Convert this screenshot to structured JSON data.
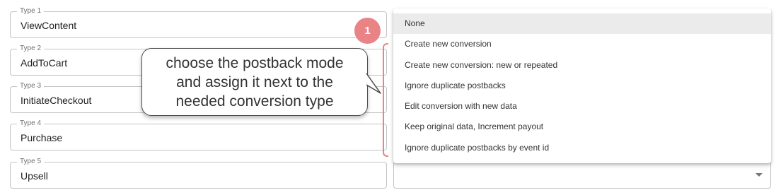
{
  "conversion_types": [
    {
      "label": "Type 1",
      "value": "ViewContent"
    },
    {
      "label": "Type 2",
      "value": "AddToCart"
    },
    {
      "label": "Type 3",
      "value": "InitiateCheckout"
    },
    {
      "label": "Type 4",
      "value": "Purchase"
    },
    {
      "label": "Type 5",
      "value": "Upsell"
    }
  ],
  "postback_mode": {
    "options": [
      "None",
      "Create new conversion",
      "Create new conversion: new or repeated",
      "Ignore duplicate postbacks",
      "Edit conversion with new data",
      "Keep original data, Increment payout",
      "Ignore duplicate postbacks by event id"
    ],
    "selected": "None"
  },
  "annotation": {
    "step_number": "1",
    "callout_lines": [
      "choose the postback mode",
      "and assign it next to the",
      "needed conversion type"
    ]
  },
  "colors": {
    "accent": "#e98386",
    "border": "#c4c4c4",
    "selected_bg": "#ebebeb"
  }
}
